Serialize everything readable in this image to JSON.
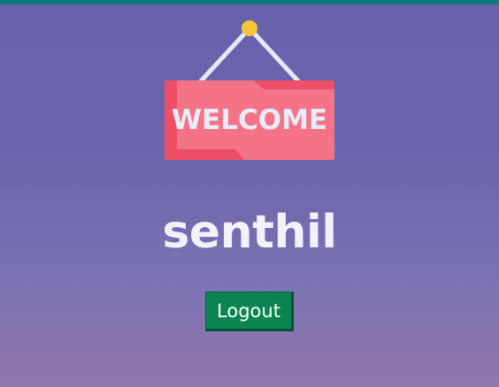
{
  "header": {
    "accent_color": "#0e7a7a"
  },
  "welcome_sign": {
    "icon": "welcome-sign-icon",
    "text": "WELCOME",
    "colors": {
      "board": "#f47387",
      "board_dark": "#ee4f67",
      "text": "#e9ecf7",
      "string": "#e3ebfb",
      "pin": "#f5c638"
    }
  },
  "user": {
    "name": "senthil"
  },
  "actions": {
    "logout_label": "Logout",
    "logout_color": "#0a8551"
  },
  "background": {
    "gradient_top": "#6761ab",
    "gradient_bottom": "#9076ab"
  }
}
